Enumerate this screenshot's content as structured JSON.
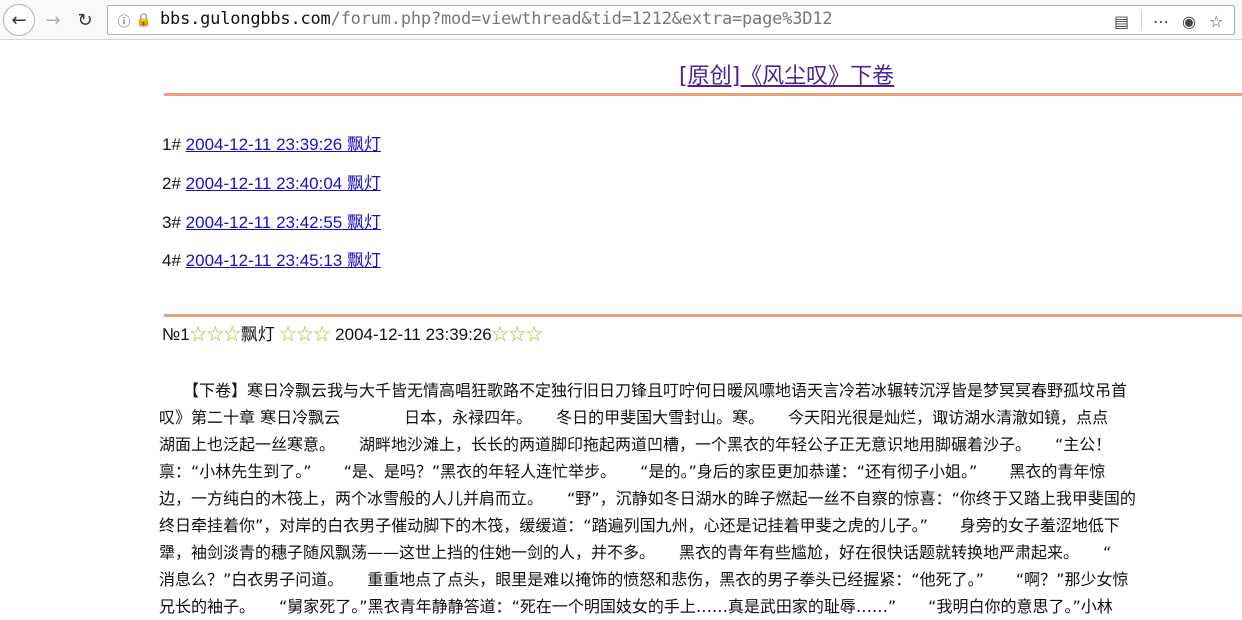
{
  "browser": {
    "url_host": "bbs.gulongbbs.com",
    "url_path": "/forum.php?mod=viewthread&tid=1212&extra=page%3D12"
  },
  "thread": {
    "title": "[原创]《风尘叹》下卷"
  },
  "post_index": [
    {
      "num": "1#",
      "link": "2004-12-11 23:39:26 飘灯"
    },
    {
      "num": "2#",
      "link": "2004-12-11 23:40:04 飘灯"
    },
    {
      "num": "3#",
      "link": "2004-12-11 23:42:55 飘灯"
    },
    {
      "num": "4#",
      "link": "2004-12-11 23:45:13 飘灯"
    }
  ],
  "post": {
    "number": "№1",
    "stars": "☆☆☆",
    "author": "飘灯",
    "time": "2004-12-11 23:39:26"
  },
  "body_lines": [
    "　　【下卷】寒日冷飘云我与大千皆无情高唱狂歌路不定独行旧日刀锋且叮咛何日暖风嘌地语天言冷若冰辗转沉浮皆是梦冥冥春野孤坟吊首",
    "叹》第二十章 寒日冷飘云　　　　日本，永禄四年。　　冬日的甲斐国大雪封山。寒。　　今天阳光很是灿烂，诹访湖水清澈如镜，点点",
    "湖面上也泛起一丝寒意。　　湖畔地沙滩上，长长的两道脚印拖起两道凹槽，一个黑衣的年轻公子正无意识地用脚碾着沙子。　　“主公！",
    "禀：“小林先生到了。”　　“是、是吗？”黑衣的年轻人连忙举步。　　“是的。”身后的家臣更加恭谨：“还有彻子小姐。”　　黑衣的青年惊",
    "边，一方纯白的木筏上，两个冰雪般的人儿并肩而立。　　“野”，沉静如冬日湖水的眸子燃起一丝不自察的惊喜：“你终于又踏上我甲斐国的",
    "终日牵挂着你”，对岸的白衣男子催动脚下的木筏，缓缓道：“踏遍列国九州，心还是记挂着甲斐之虎的儿子。”　　身旁的女子羞涩地低下",
    "犟，袖剑淡青的穗子随风飘荡——这世上挡的住她一剑的人，并不多。　　黑衣的青年有些尴尬，好在很快话题就转换地严肃起来。　　“",
    "消息么？”白衣男子问道。　　重重地点了点头，眼里是难以掩饰的愤怒和悲伤，黑衣的男子拳头已经握紧：“他死了。”　　“啊？”那少女惊",
    "兄长的袖子。　　“舅家死了。”黑衣青年静静答道：“死在一个明国妓女的手上……真是武田家的耻辱……”　　“我明白你的意思了。”小林"
  ]
}
